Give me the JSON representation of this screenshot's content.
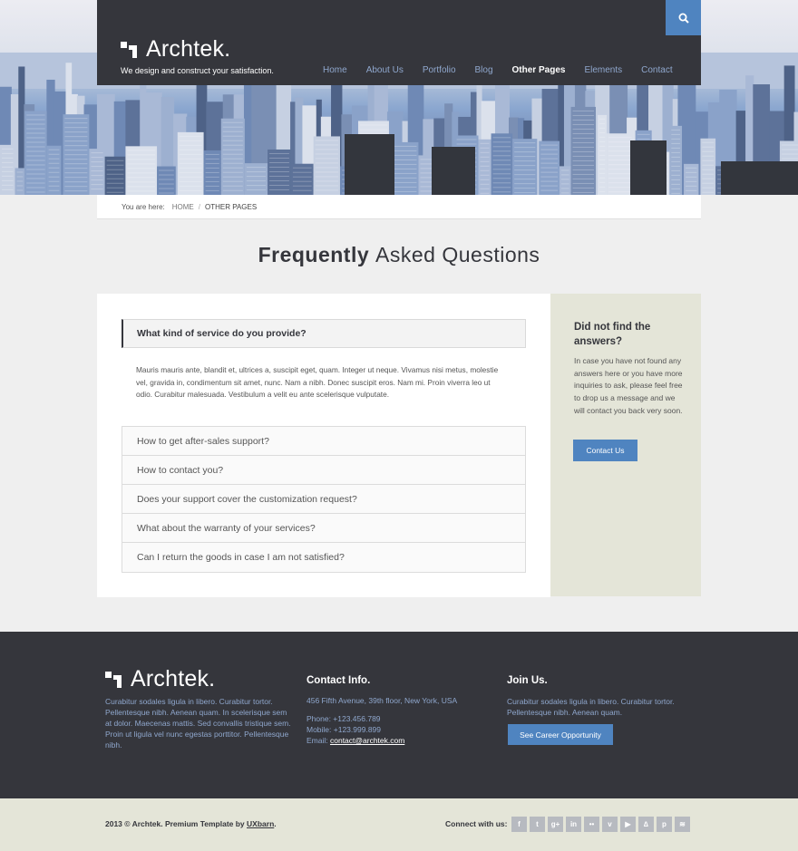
{
  "header": {
    "logo_text": "Archtek.",
    "tagline": "We design and construct your satisfaction.",
    "nav": [
      {
        "label": "Home",
        "active": false
      },
      {
        "label": "About Us",
        "active": false
      },
      {
        "label": "Portfolio",
        "active": false
      },
      {
        "label": "Blog",
        "active": false
      },
      {
        "label": "Other Pages",
        "active": true
      },
      {
        "label": "Elements",
        "active": false
      },
      {
        "label": "Contact",
        "active": false
      }
    ],
    "search_icon": "search-icon"
  },
  "breadcrumb": {
    "label": "You are here:",
    "home": "HOME",
    "separator": "/",
    "current": "OTHER PAGES"
  },
  "page_title": {
    "bold": "Frequently",
    "light": "Asked Questions"
  },
  "faq": {
    "open_question": "What kind of service do you provide?",
    "open_answer": "Mauris mauris ante, blandit et, ultrices a, suscipit eget, quam. Integer ut neque. Vivamus nisi metus, molestie vel, gravida in, condimentum sit amet, nunc. Nam a nibh. Donec suscipit eros. Nam mi. Proin viverra leo ut odio. Curabitur malesuada. Vestibulum a velit eu ante scelerisque vulputate.",
    "questions": [
      "How to get after-sales support?",
      "How to contact you?",
      "Does your support cover the customization request?",
      "What about the warranty of your services?",
      "Can I return the goods in case I am not satisfied?"
    ]
  },
  "sidebar": {
    "title": "Did not find the answers?",
    "text": "In case you have not found any answers here or you have more inquiries to ask, please feel free to drop us a message and we will contact you back very soon.",
    "button": "Contact Us"
  },
  "footer": {
    "logo_text": "Archtek.",
    "about": "Curabitur sodales ligula in libero. Curabitur tortor. Pellentesque nibh. Aenean quam. In scelerisque sem at dolor. Maecenas mattis. Sed convallis tristique sem. Proin ut ligula vel nunc egestas porttitor. Pellentesque nibh.",
    "contact_title": "Contact Info.",
    "address": "456 Fifth Avenue, 39th floor, New York, USA",
    "phone": "Phone: +123.456.789",
    "mobile": "Mobile: +123.999.899",
    "email_label": "Email: ",
    "email": "contact@archtek.com",
    "join_title": "Join Us.",
    "join_text": "Curabitur sodales ligula in libero. Curabitur tortor. Pellentesque nibh. Aenean quam.",
    "join_button": "See Career Opportunity"
  },
  "bottom": {
    "copyright": "2013 © Archtek. Premium Template by ",
    "author": "UXbarn",
    "period": ".",
    "connect_label": "Connect with us:",
    "socials": [
      {
        "icon": "facebook-icon",
        "glyph": "f"
      },
      {
        "icon": "twitter-icon",
        "glyph": "t"
      },
      {
        "icon": "google-plus-icon",
        "glyph": "g+"
      },
      {
        "icon": "linkedin-icon",
        "glyph": "in"
      },
      {
        "icon": "flickr-icon",
        "glyph": "••"
      },
      {
        "icon": "vimeo-icon",
        "glyph": "v"
      },
      {
        "icon": "youtube-icon",
        "glyph": "▶"
      },
      {
        "icon": "tumblr-icon",
        "glyph": "∆"
      },
      {
        "icon": "pinterest-icon",
        "glyph": "p"
      },
      {
        "icon": "rss-icon",
        "glyph": "≋"
      }
    ]
  },
  "colors": {
    "dark": "#35363c",
    "accent": "#4f84c0",
    "link": "#8fa7cd",
    "sand": "#e4e5d8"
  }
}
